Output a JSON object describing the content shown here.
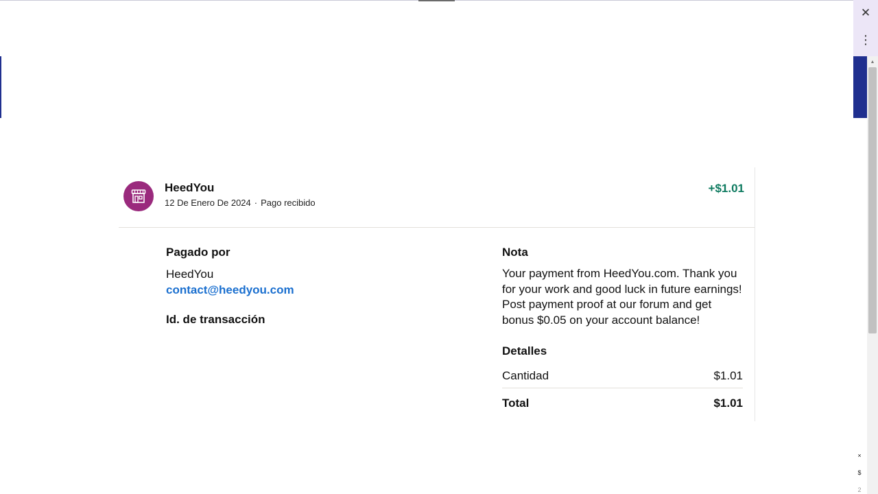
{
  "browser": {
    "close_icon": "close-icon",
    "menu_icon": "more-vertical-icon",
    "close_glyph": "✕",
    "menu_glyph": "⋮",
    "mini_stack": [
      "×",
      "$",
      "2"
    ]
  },
  "transaction": {
    "merchant_name": "HeedYou",
    "date": "12 De Enero De 2024",
    "separator": "·",
    "status": "Pago recibido",
    "amount": "+$1.01",
    "avatar_icon": "store-icon",
    "avatar_color": "#9a2a7d",
    "amount_color": "#0d7a5f"
  },
  "paid_by": {
    "title": "Pagado por",
    "name": "HeedYou",
    "email": "contact@heedyou.com"
  },
  "transaction_id": {
    "title": "Id. de transacción",
    "value": ""
  },
  "note": {
    "title": "Nota",
    "body": "Your payment from HeedYou.com. Thank you for your work and good luck in future earnings! Post payment proof at our forum and get bonus $0.05 on your account balance!"
  },
  "details": {
    "title": "Detalles",
    "rows": [
      {
        "label": "Cantidad",
        "value": "$1.01"
      },
      {
        "label": "Total",
        "value": "$1.01"
      }
    ]
  },
  "colors": {
    "link": "#1a6fcf",
    "side_panel": "#ece6f7",
    "brand_blue": "#1f2f8f"
  }
}
